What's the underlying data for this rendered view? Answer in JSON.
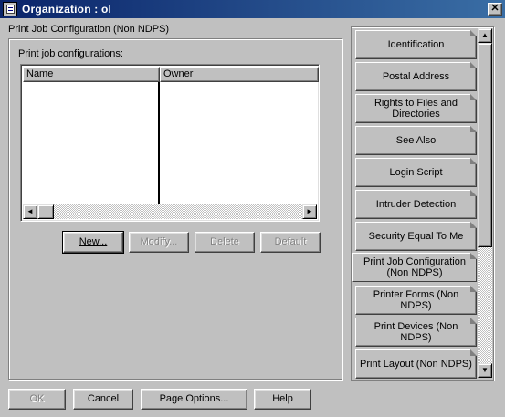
{
  "window": {
    "title": "Organization : ol",
    "close_glyph": "✕"
  },
  "page": {
    "heading": "Print Job Configuration (Non NDPS)",
    "list_label": "Print job configurations:",
    "columns": [
      "Name",
      "Owner"
    ]
  },
  "scrollbars": {
    "left_arrow": "◄",
    "right_arrow": "►",
    "up_arrow": "▲",
    "down_arrow": "▼"
  },
  "action_buttons": {
    "new": "New...",
    "modify": "Modify...",
    "delete": "Delete",
    "default": "Default"
  },
  "tabs": [
    "Identification",
    "Postal Address",
    "Rights to Files and Directories",
    "See Also",
    "Login Script",
    "Intruder Detection",
    "Security Equal To Me",
    "Print Job Configuration (Non NDPS)",
    "Printer Forms (Non NDPS)",
    "Print Devices (Non NDPS)",
    "Print Layout (Non NDPS)"
  ],
  "active_tab": "Print Job Configuration (Non NDPS)",
  "footer_buttons": {
    "ok": "OK",
    "cancel": "Cancel",
    "page_options": "Page Options...",
    "help": "Help"
  }
}
